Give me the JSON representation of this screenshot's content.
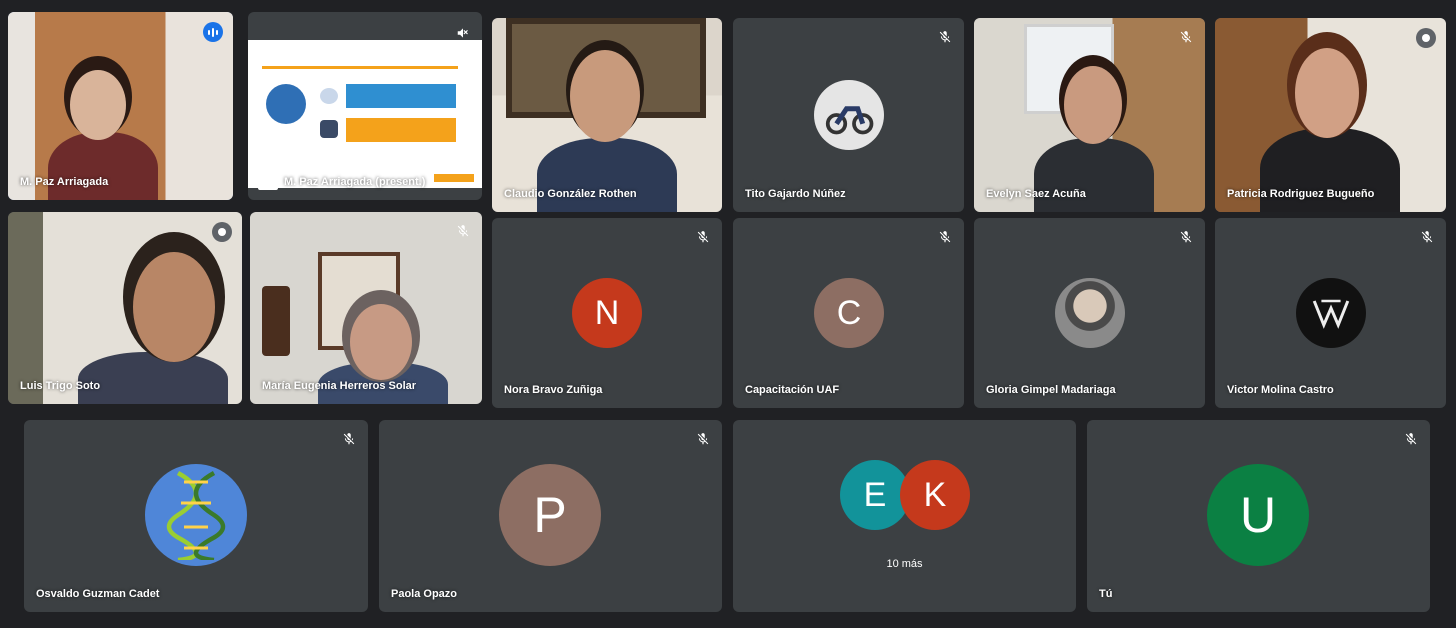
{
  "tiles": {
    "t1": {
      "name": "M. Paz Arriagada"
    },
    "t2": {
      "name": "M. Paz Arriagada (present.)"
    },
    "t3": {
      "name": "Claudio González Rothen"
    },
    "t4": {
      "name": "Tito Gajardo Núñez"
    },
    "t5": {
      "name": "Evelyn Saez Acuña"
    },
    "t6": {
      "name": "Patricia Rodriguez Bugueño"
    },
    "t7": {
      "name": "Luis Trigo Soto"
    },
    "t8": {
      "name": "María Eugenia Herreros Solar"
    },
    "t9": {
      "name": "Nora Bravo Zuñiga",
      "initial": "N",
      "color": "#c5391c"
    },
    "t10": {
      "name": "Capacitación UAF",
      "initial": "C",
      "color": "#8d6e63"
    },
    "t11": {
      "name": "Gloria Gimpel Madariaga"
    },
    "t12": {
      "name": "Victor Molina Castro"
    },
    "t13": {
      "name": "Osvaldo Guzman Cadet"
    },
    "t14": {
      "name": "Paola Opazo",
      "initial": "P",
      "color": "#8d6e63"
    },
    "t15": {
      "initials": [
        "E",
        "K"
      ],
      "colors": [
        "#12939a",
        "#c5391c"
      ],
      "more": "10 más"
    },
    "t16": {
      "name": "Tú",
      "initial": "U",
      "color": "#0b8043"
    }
  },
  "icons": {
    "mic_off": "mic-off-icon",
    "speaking": "audio-level-icon",
    "present": "present-screen-icon",
    "volume_off": "volume-off-icon"
  }
}
